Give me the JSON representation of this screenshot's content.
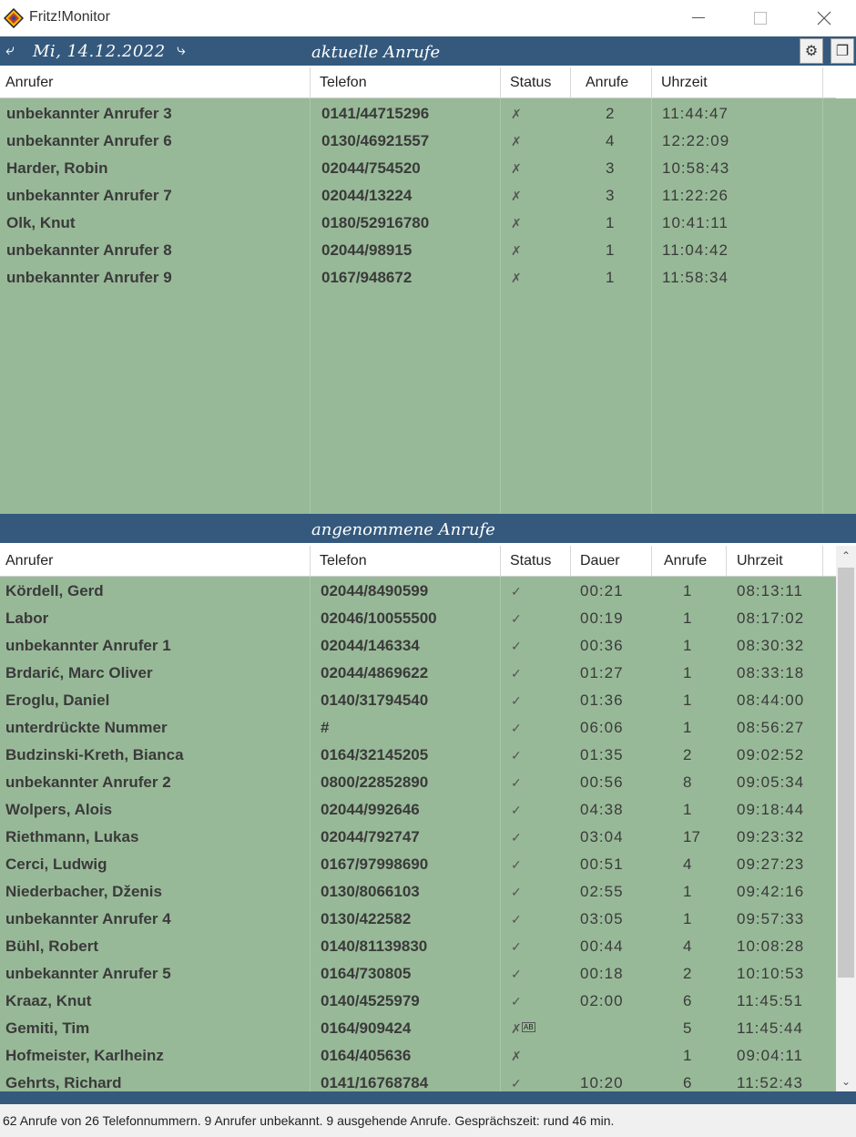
{
  "window": {
    "title": "Fritz!Monitor"
  },
  "nav": {
    "date": "Mi, 14.12.2022"
  },
  "current": {
    "title": "aktuelle Anrufe",
    "columns": [
      "Anrufer",
      "Telefon",
      "Status",
      "Anrufe",
      "Uhrzeit"
    ],
    "rows": [
      {
        "caller": "unbekannter Anrufer 3",
        "phone": "0141/44715296",
        "status": "✗",
        "count": "2",
        "time": "11:44:47"
      },
      {
        "caller": "unbekannter Anrufer 6",
        "phone": "0130/46921557",
        "status": "✗",
        "count": "4",
        "time": "12:22:09"
      },
      {
        "caller": "Harder, Robin",
        "phone": "02044/754520",
        "status": "✗",
        "count": "3",
        "time": "10:58:43"
      },
      {
        "caller": "unbekannter Anrufer 7",
        "phone": "02044/13224",
        "status": "✗",
        "count": "3",
        "time": "11:22:26"
      },
      {
        "caller": "Olk, Knut",
        "phone": "0180/52916780",
        "status": "✗",
        "count": "1",
        "time": "10:41:11"
      },
      {
        "caller": "unbekannter Anrufer 8",
        "phone": "02044/98915",
        "status": "✗",
        "count": "1",
        "time": "11:04:42"
      },
      {
        "caller": "unbekannter Anrufer 9",
        "phone": "0167/948672",
        "status": "✗",
        "count": "1",
        "time": "11:58:34"
      }
    ]
  },
  "accepted": {
    "title": "angenommene Anrufe",
    "columns": [
      "Anrufer",
      "Telefon",
      "Status",
      "Dauer",
      "Anrufe",
      "Uhrzeit"
    ],
    "rows": [
      {
        "caller": "Kördell, Gerd",
        "phone": "02044/8490599",
        "status": "✓",
        "duration": "00:21",
        "count": "1",
        "time": "08:13:11"
      },
      {
        "caller": "Labor",
        "phone": "02046/10055500",
        "status": "✓",
        "duration": "00:19",
        "count": "1",
        "time": "08:17:02"
      },
      {
        "caller": "unbekannter Anrufer 1",
        "phone": "02044/146334",
        "status": "✓",
        "duration": "00:36",
        "count": "1",
        "time": "08:30:32"
      },
      {
        "caller": "Brdarić,  Marc Oliver",
        "phone": "02044/4869622",
        "status": "✓",
        "duration": "01:27",
        "count": "1",
        "time": "08:33:18"
      },
      {
        "caller": "Eroglu,  Daniel",
        "phone": "0140/31794540",
        "status": "✓",
        "duration": "01:36",
        "count": "1",
        "time": "08:44:00"
      },
      {
        "caller": "unterdrückte Nummer",
        "phone": "#",
        "status": "✓",
        "duration": "06:06",
        "count": "1",
        "time": "08:56:27"
      },
      {
        "caller": "Budzinski-Kreth, Bianca",
        "phone": "0164/32145205",
        "status": "✓",
        "duration": "01:35",
        "count": "2",
        "time": "09:02:52"
      },
      {
        "caller": "unbekannter Anrufer 2",
        "phone": "0800/22852890",
        "status": "✓",
        "duration": "00:56",
        "count": "8",
        "time": "09:05:34"
      },
      {
        "caller": "Wolpers, Alois",
        "phone": "02044/992646",
        "status": "✓",
        "duration": "04:38",
        "count": "1",
        "time": "09:18:44"
      },
      {
        "caller": "Riethmann, Lukas",
        "phone": "02044/792747",
        "status": "✓",
        "duration": "03:04",
        "count": "17",
        "time": "09:23:32"
      },
      {
        "caller": "Cerci, Ludwig",
        "phone": "0167/97998690",
        "status": "✓",
        "duration": "00:51",
        "count": "4",
        "time": "09:27:23"
      },
      {
        "caller": "Niederbacher,  Dženis",
        "phone": "0130/8066103",
        "status": "✓",
        "duration": "02:55",
        "count": "1",
        "time": "09:42:16"
      },
      {
        "caller": "unbekannter Anrufer 4",
        "phone": "0130/422582",
        "status": "✓",
        "duration": "03:05",
        "count": "1",
        "time": "09:57:33"
      },
      {
        "caller": "Bühl,  Robert",
        "phone": "0140/81139830",
        "status": "✓",
        "duration": "00:44",
        "count": "4",
        "time": "10:08:28"
      },
      {
        "caller": "unbekannter Anrufer 5",
        "phone": "0164/730805",
        "status": "✓",
        "duration": "00:18",
        "count": "2",
        "time": "10:10:53"
      },
      {
        "caller": "Kraaz,  Knut",
        "phone": "0140/4525979",
        "status": "✓",
        "duration": "02:00",
        "count": "6",
        "time": "11:45:51"
      },
      {
        "caller": "Gemiti, Tim",
        "phone": "0164/909424",
        "status": "✗",
        "badge": "AB",
        "duration": "",
        "count": "5",
        "time": "11:45:44"
      },
      {
        "caller": "Hofmeister,  Karlheinz",
        "phone": "0164/405636",
        "status": "✗",
        "duration": "",
        "count": "1",
        "time": "09:04:11"
      },
      {
        "caller": "Gehrts, Richard",
        "phone": "0141/16768784",
        "status": "✓",
        "duration": "10:20",
        "count": "6",
        "time": "11:52:43"
      }
    ]
  },
  "statusbar": {
    "text": "62 Anrufe von 26 Telefonnummern. 9 Anrufer unbekannt. 9 ausgehende Anrufe. Gesprächszeit: rund 46 min."
  },
  "colors": {
    "bar": "#34597d",
    "grid": "#98b998",
    "header": "#ffffff"
  },
  "icons": {
    "app": "fritz-diamond-icon",
    "back": "arrow-left-icon",
    "forward": "arrow-right-icon",
    "settings": "gear-icon",
    "window": "window-icon"
  }
}
